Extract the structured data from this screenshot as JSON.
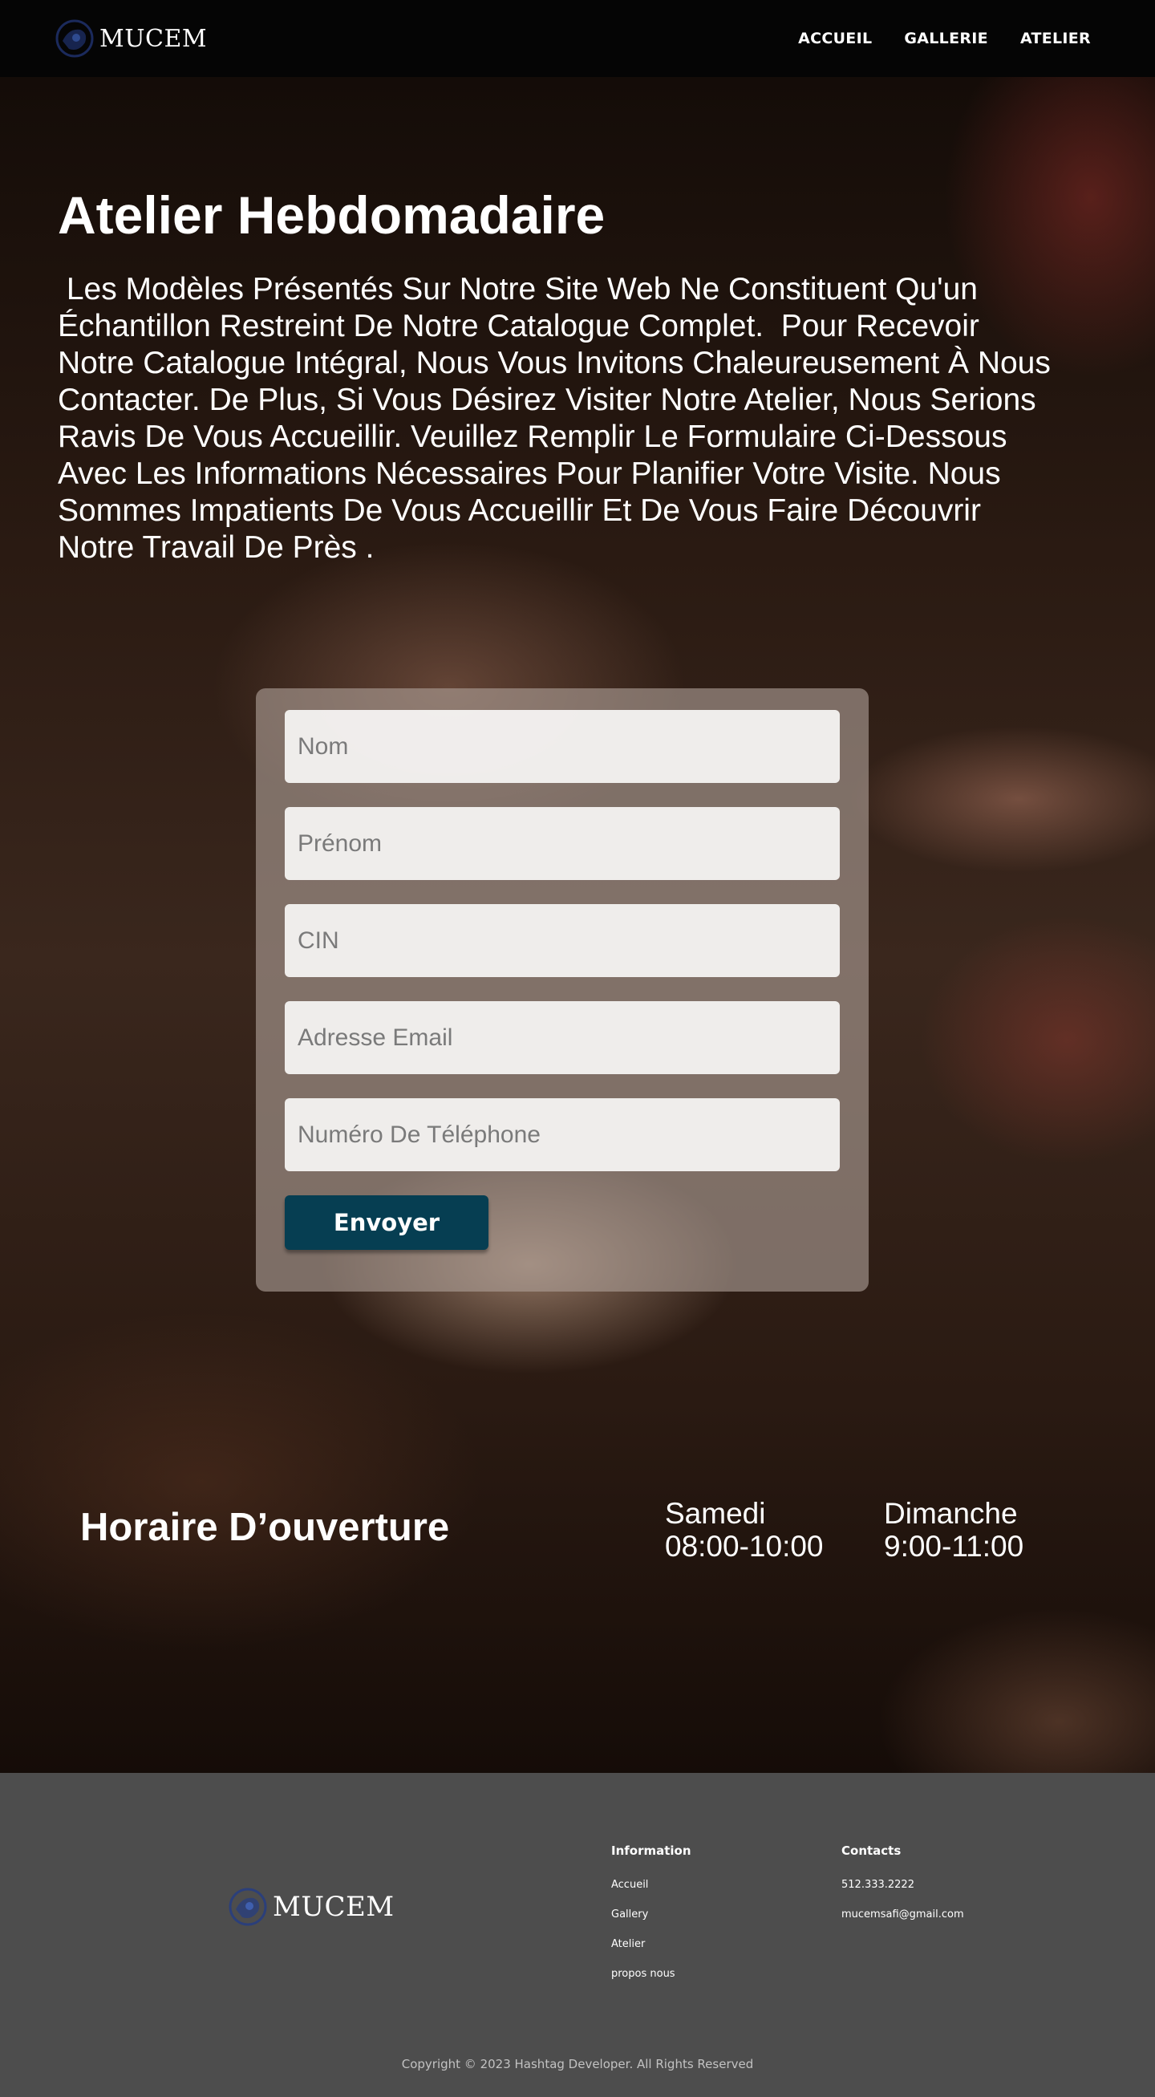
{
  "brand": {
    "name": "MUCEM",
    "accent": "#063e52"
  },
  "nav": {
    "links": [
      {
        "label": "ACCUEIL"
      },
      {
        "label": "GALLERIE"
      },
      {
        "label": "ATELIER"
      }
    ]
  },
  "hero": {
    "title": "Atelier Hebdomadaire",
    "text": " Les Modèles Présentés Sur Notre Site Web Ne Constituent Qu'un Échantillon Restreint De Notre Catalogue Complet.  Pour Recevoir Notre Catalogue Intégral, Nous Vous Invitons Chaleureusement À Nous Contacter. De Plus, Si Vous Désirez Visiter Notre Atelier, Nous Serions Ravis De Vous Accueillir. Veuillez Remplir Le Formulaire Ci-Dessous Avec Les Informations Nécessaires Pour Planifier Votre Visite. Nous Sommes Impatients De Vous Accueillir Et De Vous Faire Découvrir Notre Travail De Près ."
  },
  "form": {
    "nom_placeholder": "Nom",
    "prenom_placeholder": "Prénom",
    "cin_placeholder": "CIN",
    "email_placeholder": "Adresse Email",
    "phone_placeholder": "Numéro De Téléphone",
    "submit_label": "Envoyer"
  },
  "hours": {
    "title": "Horaire D’ouverture",
    "days": [
      {
        "day": "Samedi",
        "time": "08:00-10:00"
      },
      {
        "day": "Dimanche",
        "time": "9:00-11:00"
      }
    ]
  },
  "footer": {
    "info_title": "Information",
    "info_links": [
      "Accueil",
      "Gallery",
      "Atelier",
      "propos nous"
    ],
    "contact_title": "Contacts",
    "phone": "512.333.2222",
    "email": "mucemsafi@gmail.com",
    "copyright": "Copyright © 2023 Hashtag Developer. All Rights Reserved"
  }
}
